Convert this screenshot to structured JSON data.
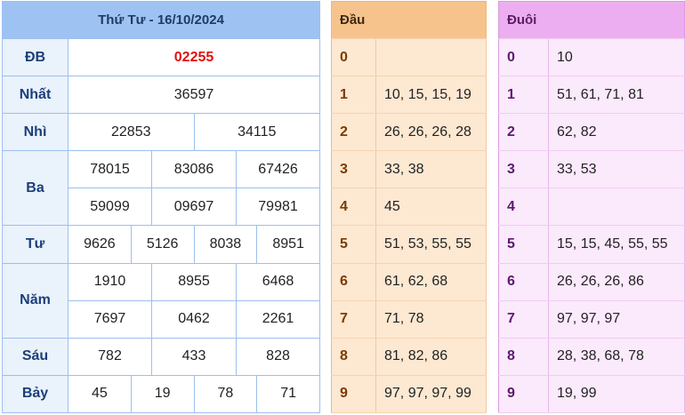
{
  "results": {
    "title": "Thứ Tư - 16/10/2024",
    "prizes": {
      "db": {
        "label": "ĐB",
        "values": [
          "02255"
        ]
      },
      "nhat": {
        "label": "Nhất",
        "values": [
          "36597"
        ]
      },
      "nhi": {
        "label": "Nhì",
        "values": [
          "22853",
          "34115"
        ]
      },
      "ba": {
        "label": "Ba",
        "values": [
          "78015",
          "83086",
          "67426",
          "59099",
          "09697",
          "79981"
        ]
      },
      "tu": {
        "label": "Tư",
        "values": [
          "9626",
          "5126",
          "8038",
          "8951"
        ]
      },
      "nam": {
        "label": "Năm",
        "values": [
          "1910",
          "8955",
          "6468",
          "7697",
          "0462",
          "2261"
        ]
      },
      "sau": {
        "label": "Sáu",
        "values": [
          "782",
          "433",
          "828"
        ]
      },
      "bay": {
        "label": "Bảy",
        "values": [
          "45",
          "19",
          "78",
          "71"
        ]
      }
    },
    "highlight_color": "#e01010"
  },
  "dau": {
    "header": "Đầu",
    "rows": [
      {
        "digit": "0",
        "values": ""
      },
      {
        "digit": "1",
        "values": "10, 15, 15, 19"
      },
      {
        "digit": "2",
        "values": "26, 26, 26, 28"
      },
      {
        "digit": "3",
        "values": "33, 38"
      },
      {
        "digit": "4",
        "values": "45"
      },
      {
        "digit": "5",
        "values": "51, 53, 55, 55"
      },
      {
        "digit": "6",
        "values": "61, 62, 68"
      },
      {
        "digit": "7",
        "values": "71, 78"
      },
      {
        "digit": "8",
        "values": "81, 82, 86"
      },
      {
        "digit": "9",
        "values": "97, 97, 97, 99"
      }
    ],
    "color": "#f7c38d"
  },
  "duoi": {
    "header": "Đuôi",
    "rows": [
      {
        "digit": "0",
        "values": "10"
      },
      {
        "digit": "1",
        "values": "51, 61, 71, 81"
      },
      {
        "digit": "2",
        "values": "62, 82"
      },
      {
        "digit": "3",
        "values": "33, 53"
      },
      {
        "digit": "4",
        "values": ""
      },
      {
        "digit": "5",
        "values": "15, 15, 45, 55, 55"
      },
      {
        "digit": "6",
        "values": "26, 26, 26, 86"
      },
      {
        "digit": "7",
        "values": "97, 97, 97"
      },
      {
        "digit": "8",
        "values": "28, 38, 68, 78"
      },
      {
        "digit": "9",
        "values": "19, 99"
      }
    ],
    "color": "#ecaef0"
  }
}
